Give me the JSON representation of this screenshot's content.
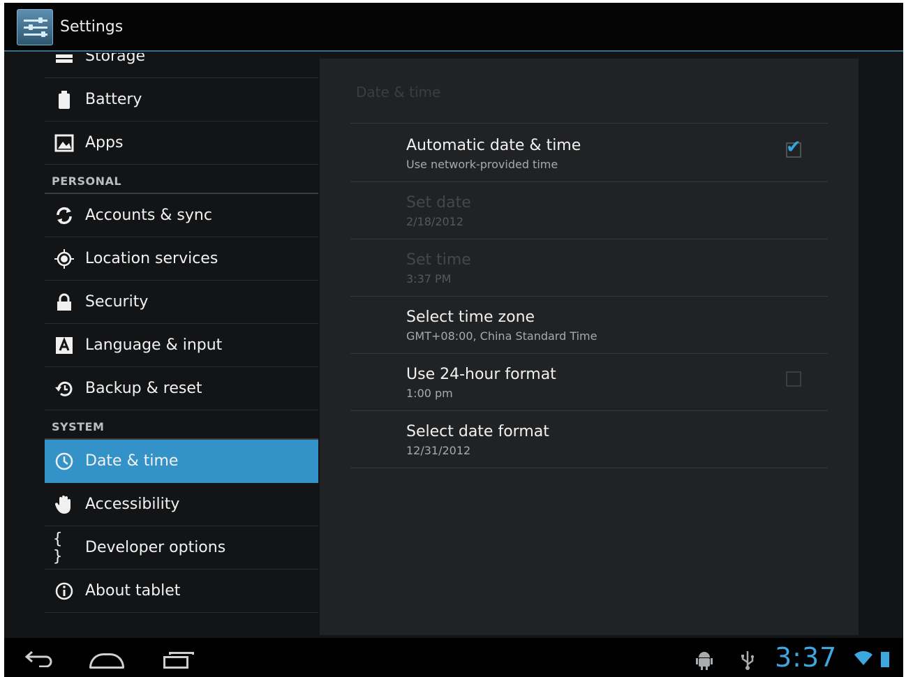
{
  "app": {
    "title": "Settings"
  },
  "sidebar": {
    "items": [
      {
        "label": "Storage",
        "icon": "storage-icon"
      },
      {
        "label": "Battery",
        "icon": "battery-icon"
      },
      {
        "label": "Apps",
        "icon": "apps-icon"
      },
      {
        "label": "Accounts & sync",
        "icon": "sync-icon"
      },
      {
        "label": "Location services",
        "icon": "location-icon"
      },
      {
        "label": "Security",
        "icon": "lock-icon"
      },
      {
        "label": "Language & input",
        "icon": "language-icon"
      },
      {
        "label": "Backup & reset",
        "icon": "backup-icon"
      },
      {
        "label": "Date & time",
        "icon": "clock-icon",
        "selected": true
      },
      {
        "label": "Accessibility",
        "icon": "hand-icon"
      },
      {
        "label": "Developer options",
        "icon": "braces-icon"
      },
      {
        "label": "About tablet",
        "icon": "info-icon"
      }
    ],
    "sections": {
      "personal": "PERSONAL",
      "system": "SYSTEM"
    }
  },
  "panel": {
    "header": "Date & time",
    "prefs": [
      {
        "title": "Automatic date & time",
        "summary": "Use network-provided time",
        "checkbox": true,
        "checked": true,
        "enabled": true
      },
      {
        "title": "Set date",
        "summary": "2/18/2012",
        "enabled": false
      },
      {
        "title": "Set time",
        "summary": "3:37 PM",
        "enabled": false
      },
      {
        "title": "Select time zone",
        "summary": "GMT+08:00, China Standard Time",
        "enabled": true
      },
      {
        "title": "Use 24-hour format",
        "summary": "1:00 pm",
        "checkbox": true,
        "checked": false,
        "enabled": true
      },
      {
        "title": "Select date format",
        "summary": "12/31/2012",
        "enabled": true
      }
    ]
  },
  "statusbar": {
    "time": "3:37",
    "accent": "#3ea7e0"
  },
  "colors": {
    "selected": "#3393c9",
    "background": "#131416",
    "panel": "#212224"
  }
}
